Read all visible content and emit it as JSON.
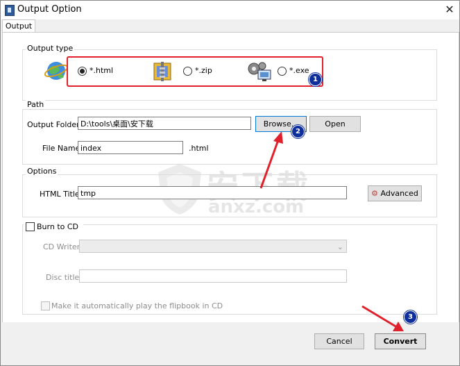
{
  "window": {
    "title": "Output Option",
    "close_glyph": "✕"
  },
  "tabs": [
    {
      "label": "Output",
      "active": true
    }
  ],
  "output_type": {
    "group_label": "Output type",
    "options": [
      {
        "label": "*.html",
        "selected": true,
        "icon": "globe-icon"
      },
      {
        "label": "*.zip",
        "selected": false,
        "icon": "zip-archive-icon"
      },
      {
        "label": "*.exe",
        "selected": false,
        "icon": "gears-exe-icon"
      }
    ]
  },
  "path": {
    "group_label": "Path",
    "output_folder_label": "Output Folder:",
    "output_folder_value": "D:\\tools\\桌面\\安下载",
    "browse_label": "Browse...",
    "open_label": "Open",
    "file_name_label": "File Name:",
    "file_name_value": "index",
    "extension": ".html"
  },
  "options": {
    "group_label": "Options",
    "html_title_label": "HTML Title:",
    "html_title_value": "tmp",
    "advanced_label": "Advanced"
  },
  "burn": {
    "checkbox_label": "Burn to CD",
    "checked": false,
    "cd_writer_label": "CD Writer",
    "cd_writer_value": "",
    "disc_title_label": "Disc title:",
    "disc_title_value": "",
    "autoplay_label": "Make it automatically play the flipbook in CD",
    "autoplay_checked": false
  },
  "footer": {
    "cancel_label": "Cancel",
    "convert_label": "Convert"
  },
  "annotations": {
    "badge_1": "1",
    "badge_2": "2",
    "badge_3": "3",
    "arrow_color": "#e0202a"
  },
  "watermark": {
    "text_cn": "安下载",
    "text_en": "anxz.com"
  }
}
